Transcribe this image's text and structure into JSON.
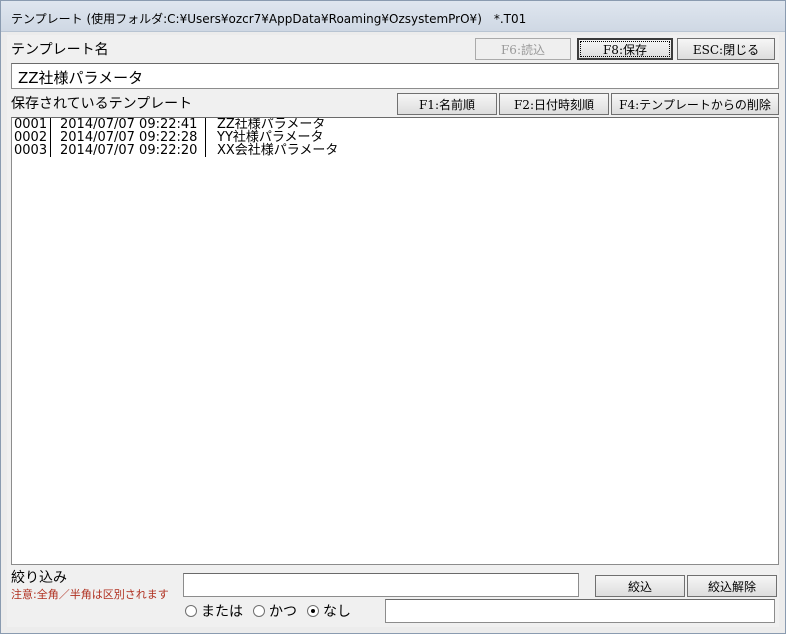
{
  "window": {
    "title": "テンプレート (使用フォルダ:C:¥Users¥ozcr7¥AppData¥Roaming¥OzsystemPrO¥)　*.T01"
  },
  "template_name": {
    "label": "テンプレート名",
    "value": "ZZ社様パラメータ"
  },
  "buttons": {
    "load": "F6:読込",
    "save": "F8:保存",
    "close": "ESC:閉じる",
    "sort_name": "F1:名前順",
    "sort_date": "F2:日付時刻順",
    "delete": "F4:テンプレートからの削除",
    "filter": "絞込",
    "clear_filter": "絞込解除"
  },
  "saved_list": {
    "label": "保存されているテンプレート",
    "rows": [
      {
        "num": "0001",
        "datetime": "2014/07/07 09:22:41",
        "name": "ZZ社様パラメータ"
      },
      {
        "num": "0002",
        "datetime": "2014/07/07 09:22:28",
        "name": "YY社様パラメータ"
      },
      {
        "num": "0003",
        "datetime": "2014/07/07 09:22:20",
        "name": "XX会社様パラメータ"
      }
    ]
  },
  "filter": {
    "label": "絞り込み",
    "note": "注意:全角／半角は区別されます",
    "value": "",
    "second_value": "",
    "options": [
      "または",
      "かつ",
      "なし"
    ],
    "selected": "なし"
  },
  "colors": {
    "note": "#b03020",
    "disabled_text": "#9a9a9a"
  }
}
